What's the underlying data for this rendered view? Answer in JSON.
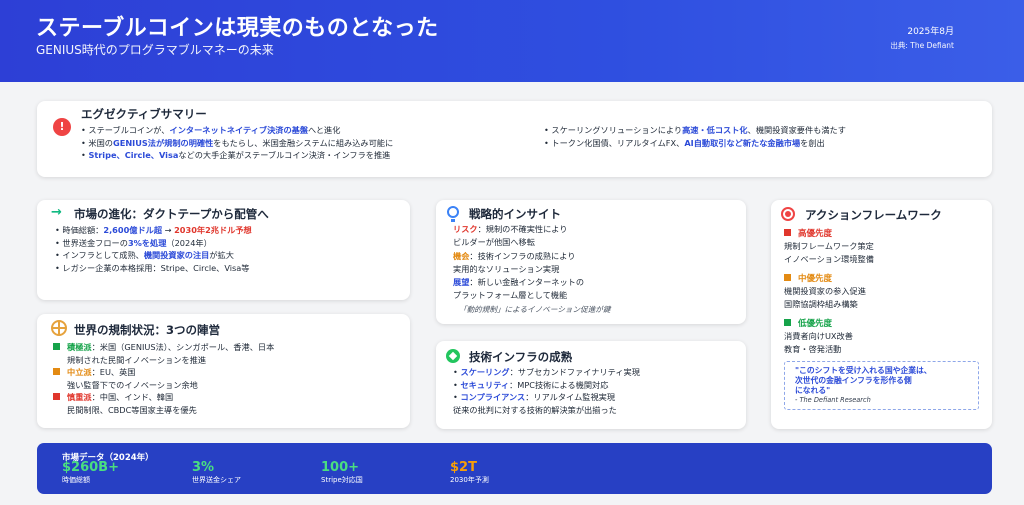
{
  "header": {
    "title": "ステーブルコインは現実のものとなった",
    "subtitle": "GENIUS時代のプログラマブルマネーの未来",
    "date": "2025年8月",
    "source": "出典: The Defiant"
  },
  "exec": {
    "title": "エグゼクティブサマリー",
    "icon": "exclamation-icon",
    "left": [
      [
        "• ステーブルコインが、",
        "インターネットネイティブ決済の基盤",
        "へと進化"
      ],
      [
        "• 米国の",
        "GENIUS法が規制の明確性",
        "をもたらし、米国金融システムに組み込み可能に"
      ],
      [
        "• ",
        "Stripe、Circle、Visa",
        "などの大手企業がステーブルコイン決済・インフラを推進"
      ]
    ],
    "right": [
      [
        "• スケーリングソリューションにより",
        "高速・低コスト化",
        "、機関投資家要件も満たす"
      ],
      [
        "• トークン化国債、リアルタイムFX、",
        "AI自動取引など新たな金融市場",
        "を創出"
      ]
    ]
  },
  "market": {
    "title": "市場の進化：ダクトテープから配管へ",
    "lines": [
      [
        "• 時価総額：",
        "2,600億ドル超",
        " → ",
        "2030年2兆ドル予想",
        ""
      ],
      [
        "• 世界送金フローの",
        "3%を処理",
        "（2024年）",
        "",
        ""
      ],
      [
        "• インフラとして成熟、",
        "機関投資家の注目",
        "が拡大",
        "",
        ""
      ],
      [
        "• レガシー企業の本格採用：Stripe、Circle、Visa等",
        "",
        "",
        "",
        ""
      ]
    ]
  },
  "regulation": {
    "title": "世界の規制状況：3つの陣営",
    "items": [
      {
        "label": "積極派",
        "rest": "：米国（GENIUS法）、シンガポール、香港、日本",
        "line2": "規制された民間イノベーションを推進",
        "color": "#16a34a"
      },
      {
        "label": "中立派",
        "rest": "：EU、英国",
        "line2": "強い監督下でのイノベーション余地",
        "color": "#e38a12"
      },
      {
        "label": "慎重派",
        "rest": "：中国、インド、韓国",
        "line2": "民間制限、CBDC等国家主導を優先",
        "color": "#e0362c"
      }
    ]
  },
  "insight": {
    "title": "戦略的インサイト",
    "blocks": [
      {
        "label": "リスク",
        "rest": "：規制の不確実性により",
        "line2": "ビルダーが他国へ移転",
        "color": "#e0362c"
      },
      {
        "label": "機会",
        "rest": "：技術インフラの成熟により",
        "line2": "実用的なソリューション実現",
        "color": "#e38a12"
      },
      {
        "label": "展望",
        "rest": "：新しい金融インターネットの",
        "line2": "プラットフォーム層として機能",
        "color": "#2c4bd8"
      }
    ],
    "note": "「動的規制」によるイノベーション促進が鍵"
  },
  "tech": {
    "title": "技術インフラの成熟",
    "lines": [
      {
        "label": "スケーリング",
        "rest": "：サブセカンドファイナリティ実現"
      },
      {
        "label": "セキュリティ",
        "rest": "：MPC技術による機関対応"
      },
      {
        "label": "コンプライアンス",
        "rest": "：リアルタイム監視実現"
      }
    ],
    "footer": "従来の批判に対する技術的解決策が出揃った"
  },
  "action": {
    "title": "アクションフレームワーク",
    "priorities": [
      {
        "title": "高優先度",
        "items": [
          "規制フレームワーク策定",
          "イノベーション環境整備"
        ],
        "color": "#e0362c"
      },
      {
        "title": "中優先度",
        "items": [
          "機関投資家の参入促進",
          "国際協調枠組み構築"
        ],
        "color": "#e38a12"
      },
      {
        "title": "低優先度",
        "items": [
          "消費者向けUX改善",
          "教育・啓発活動"
        ],
        "color": "#16a34a"
      }
    ],
    "quote": [
      "\"このシフトを受け入れる国や企業は、",
      "次世代の金融インフラを形作る側",
      "になれる\""
    ],
    "quote_by": "- The Defiant Research"
  },
  "banner": {
    "title": "市場データ（2024年）",
    "stats": [
      {
        "value": "$260B+",
        "label": "時価総額",
        "color": "#4ade80"
      },
      {
        "value": "3%",
        "label": "世界送金シェア",
        "color": "#4ade80"
      },
      {
        "value": "100+",
        "label": "Stripe対応国",
        "color": "#4ade80"
      },
      {
        "value": "$2T",
        "label": "2030年予測",
        "color": "#f59e0b"
      }
    ]
  }
}
